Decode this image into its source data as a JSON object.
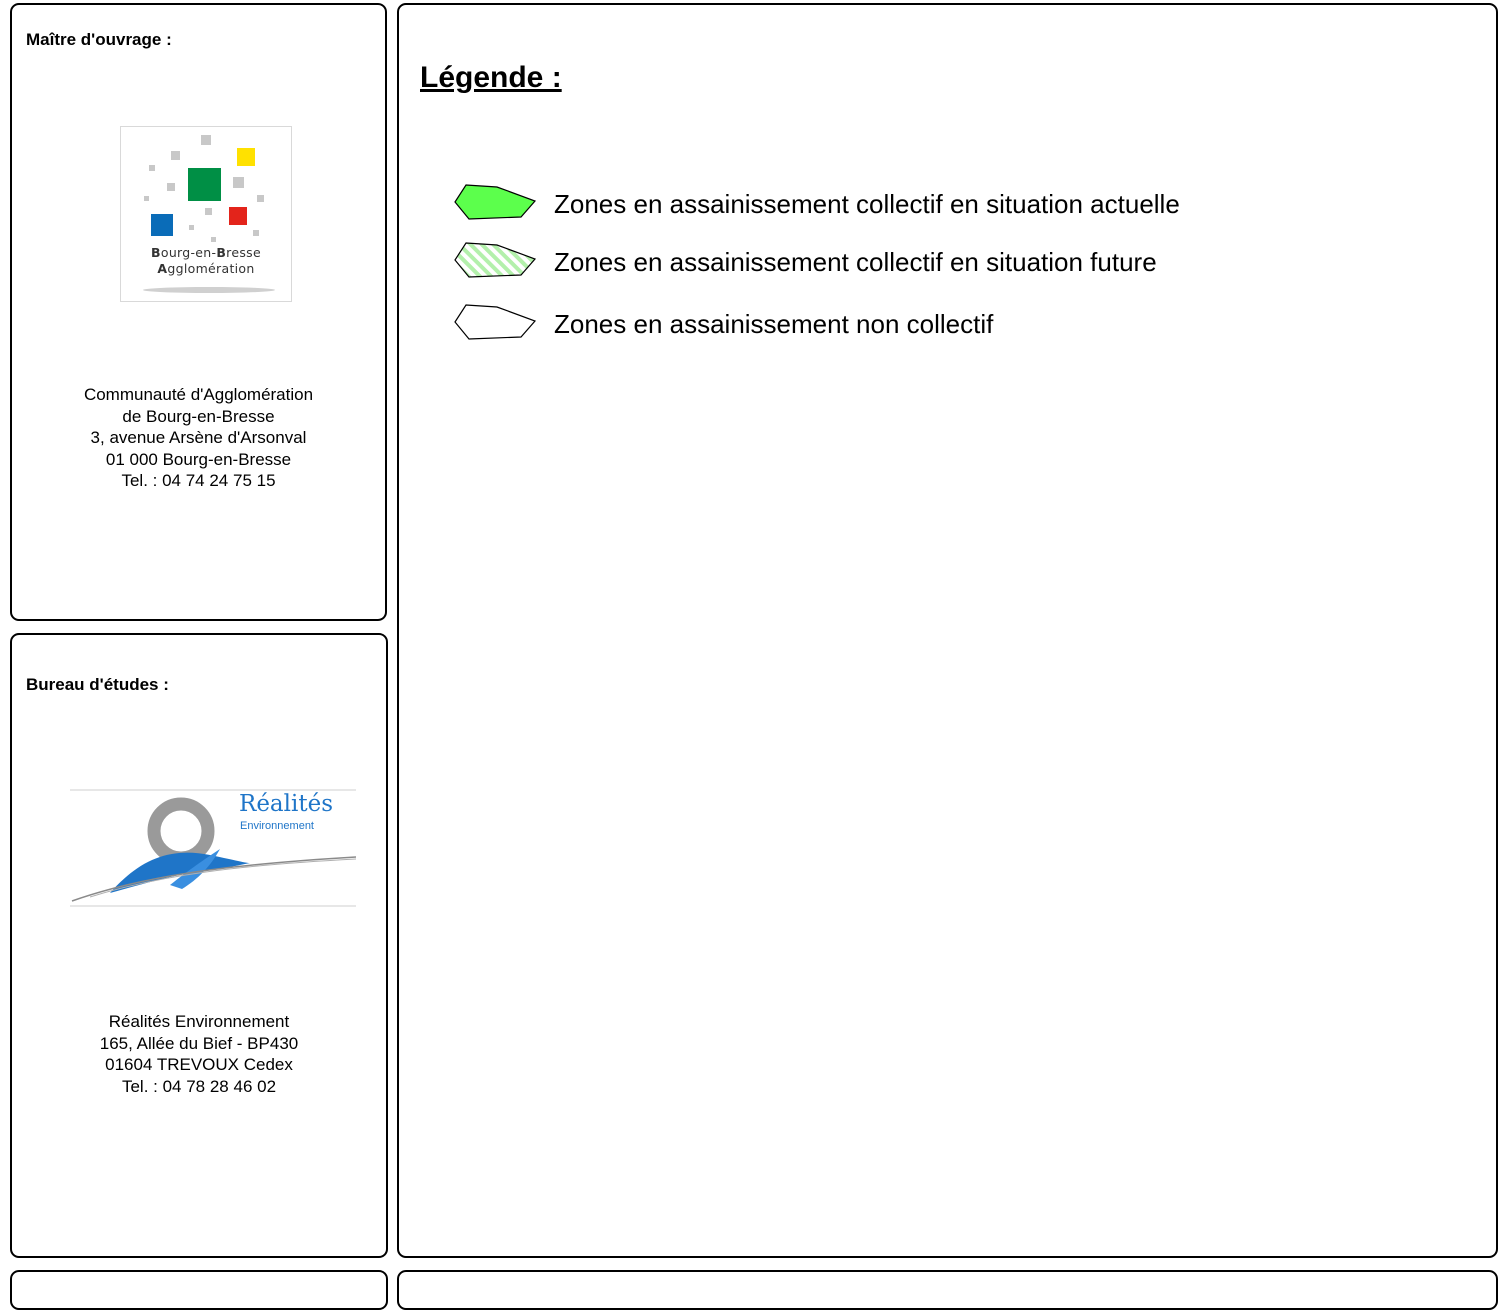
{
  "owner_panel": {
    "label": "Maître d'ouvrage :",
    "logo": {
      "line1_initial": "B",
      "line1_rest": "ourg-en-",
      "line1_initial2": "B",
      "line1_rest2": "resse",
      "line2_initial": "A",
      "line2_rest": "gglomération"
    },
    "address": [
      "Communauté d'Agglomération",
      "de Bourg-en-Bresse",
      "3, avenue Arsène d'Arsonval",
      "01 000 Bourg-en-Bresse",
      "Tel. : 04 74 24 75 15"
    ]
  },
  "consultant_panel": {
    "label": "Bureau d'études :",
    "logo": {
      "name": "Réalités",
      "subtitle": "Environnement"
    },
    "address": [
      "Réalités Environnement",
      "165, Allée du Bief - BP430",
      "01604 TREVOUX Cedex",
      "Tel. : 04 78 28 46 02"
    ]
  },
  "legend": {
    "title": "Légende :",
    "items": [
      {
        "label": "Zones en assainissement collectif en situation actuelle",
        "fill": "solid",
        "color": "#5cff4c"
      },
      {
        "label": "Zones en assainissement collectif en situation future",
        "fill": "hatched",
        "color": "#b3f0ab"
      },
      {
        "label": "Zones en assainissement non collectif",
        "fill": "none",
        "color": "#ffffff"
      }
    ]
  },
  "colors": {
    "logo_gray": "#c8c8c8",
    "logo_green": "#008f45",
    "logo_yellow": "#ffe100",
    "logo_blue": "#0a6cb8",
    "logo_red": "#e3241b",
    "realites_blue": "#1f75c8"
  }
}
